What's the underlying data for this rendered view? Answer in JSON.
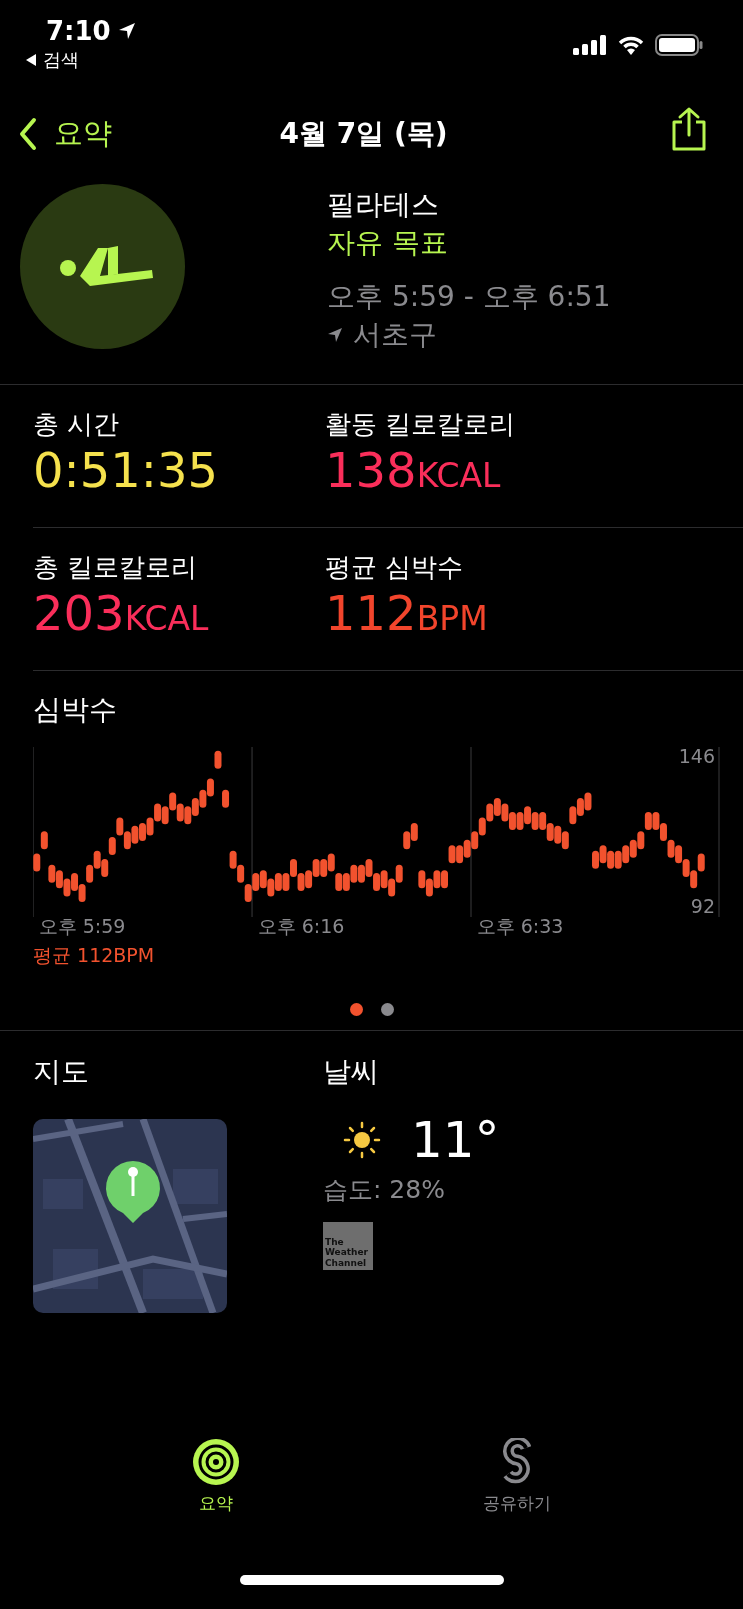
{
  "status_bar": {
    "time": "7:10",
    "back_app": "검색"
  },
  "nav": {
    "back_label": "요약",
    "title": "4월 7일 (목)"
  },
  "workout": {
    "name": "필라테스",
    "goal": "자유 목표",
    "time_range": "오후 5:59 - 오후 6:51",
    "location": "서초구"
  },
  "stats": [
    {
      "label": "총 시간",
      "value": "0:51:35",
      "color": "#f5e14d"
    },
    {
      "label": "활동 킬로칼로리",
      "value": "138",
      "unit": "KCAL",
      "color": "#fa2e5a"
    },
    {
      "label": "총 킬로칼로리",
      "value": "203",
      "unit": "KCAL",
      "color": "#fa2e5a"
    },
    {
      "label": "평균 심박수",
      "value": "112",
      "unit": "BPM",
      "color": "#f2452c"
    }
  ],
  "heart_rate": {
    "title": "심박수",
    "average": "평균 112BPM",
    "chart_data": {
      "type": "scatter",
      "ylim": [
        92,
        146
      ],
      "yticks": [
        92,
        146
      ],
      "categories": [
        null,
        null,
        null,
        null,
        null,
        null,
        "오후 5:59",
        null,
        null,
        null,
        null,
        null,
        null,
        null,
        null,
        null,
        null,
        null,
        null,
        null,
        null,
        null,
        null,
        null,
        null,
        null,
        null,
        null,
        null,
        null,
        null,
        null,
        null,
        null,
        null,
        "오후 6:16",
        null,
        null,
        null,
        null,
        null,
        null,
        null,
        null,
        null,
        null,
        null,
        null,
        null,
        null,
        null,
        null,
        null,
        null,
        null,
        null,
        null,
        null,
        null,
        null,
        null,
        null,
        null,
        null,
        "오후 6:33",
        null,
        null,
        null,
        null,
        null,
        null,
        null,
        null,
        null,
        null,
        null,
        null,
        null,
        null,
        null,
        null,
        null,
        null,
        null,
        null,
        null,
        null,
        null,
        null
      ],
      "series": [
        {
          "color": "#f2522e",
          "values": [
            108,
            116,
            104,
            102,
            99,
            101,
            97,
            104,
            109,
            106,
            114,
            121,
            116,
            118,
            119,
            121,
            126,
            125,
            130,
            126,
            125,
            128,
            131,
            135,
            145,
            131,
            109,
            104,
            97,
            101,
            102,
            99,
            101,
            101,
            106,
            101,
            102,
            106,
            106,
            108,
            101,
            101,
            104,
            104,
            106,
            101,
            102,
            99,
            104,
            116,
            119,
            102,
            99,
            102,
            102,
            111,
            111,
            113,
            116,
            121,
            126,
            128,
            126,
            123,
            123,
            125,
            123,
            123,
            119,
            118,
            116,
            125,
            128,
            130,
            109,
            111,
            109,
            109,
            111,
            113,
            116,
            123,
            123,
            119,
            113,
            111,
            106,
            102,
            108
          ]
        }
      ]
    }
  },
  "pages": [
    {
      "selected": true
    },
    {
      "selected": false
    }
  ],
  "map": {
    "title": "지도"
  },
  "weather": {
    "title": "날씨",
    "temperature": "11°",
    "humidity": "습도: 28%",
    "source": "The Weather Channel"
  },
  "tabs": [
    {
      "label": "요약",
      "selected": true
    },
    {
      "label": "공유하기",
      "selected": false
    }
  ]
}
